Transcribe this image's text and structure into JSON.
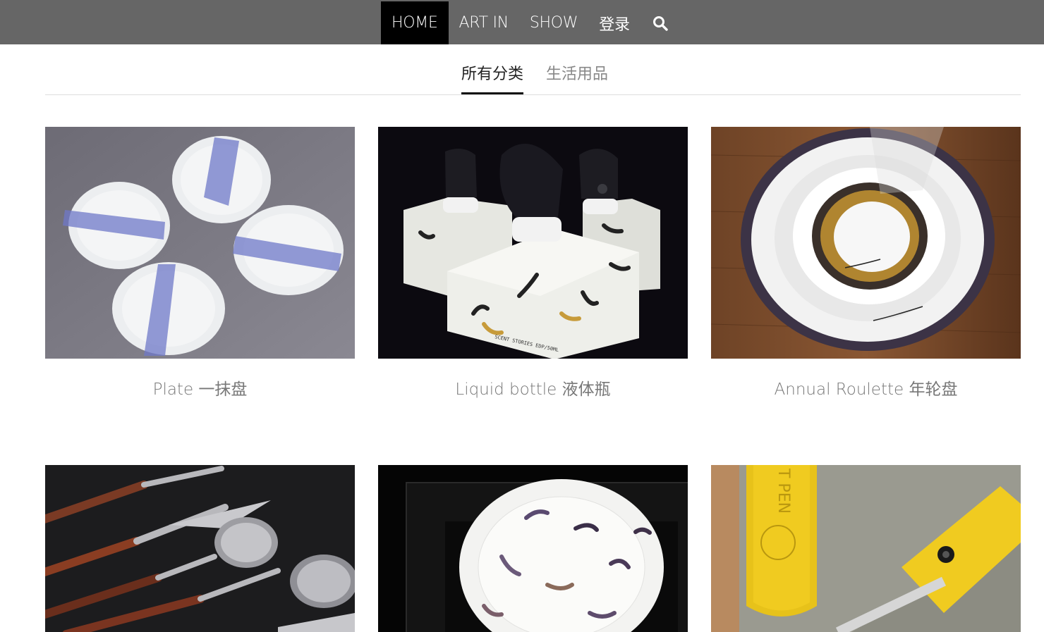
{
  "nav": {
    "items": [
      {
        "label": "HOME",
        "active": true
      },
      {
        "label": "ART IN",
        "active": false
      },
      {
        "label": "SHOW",
        "active": false
      },
      {
        "label": "登录",
        "active": false
      }
    ],
    "search_icon": "search-icon",
    "bar_color": "#666666",
    "active_color": "#000000"
  },
  "categories": [
    {
      "label": "所有分类",
      "active": true
    },
    {
      "label": "生活用品",
      "active": false
    }
  ],
  "products": [
    {
      "title": "Plate 一抹盘"
    },
    {
      "title": "Liquid bottle 液体瓶"
    },
    {
      "title": "Annual Roulette 年轮盘"
    },
    {
      "title": ""
    },
    {
      "title": ""
    },
    {
      "title": ""
    }
  ],
  "image_text": {
    "box_print": "SCENT STORIES EDP/50ML",
    "pen_print": "T PEN"
  }
}
